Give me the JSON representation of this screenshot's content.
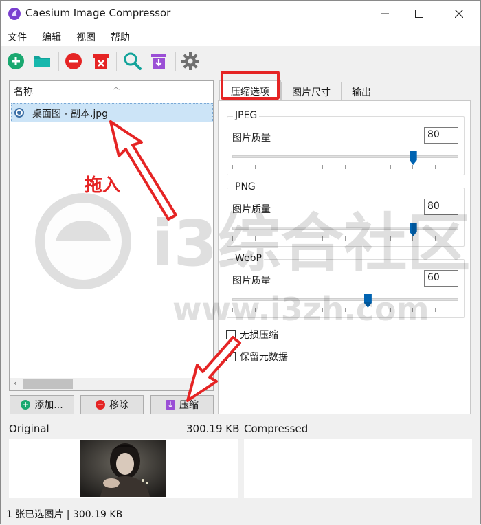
{
  "window": {
    "title": "Caesium Image Compressor",
    "controls": {
      "minimize": "—",
      "maximize": "☐",
      "close": "✕"
    }
  },
  "menu": [
    "文件",
    "编辑",
    "视图",
    "帮助"
  ],
  "toolbar": {
    "icons": [
      "add-icon",
      "open-folder-icon",
      "remove-icon",
      "clear-icon",
      "search-icon",
      "compress-archive-icon",
      "settings-icon"
    ]
  },
  "file_list": {
    "column_header": "名称",
    "items": [
      {
        "name": "桌面图 - 副本.jpg",
        "selected": true
      }
    ]
  },
  "buttons": {
    "add": "添加...",
    "remove": "移除",
    "compress": "压缩"
  },
  "tabs": [
    {
      "label": "压缩选项",
      "active": true
    },
    {
      "label": "图片尺寸",
      "active": false
    },
    {
      "label": "输出",
      "active": false
    }
  ],
  "compression": {
    "quality_label": "图片质量",
    "groups": [
      {
        "title": "JPEG",
        "quality": "80",
        "level": 80
      },
      {
        "title": "PNG",
        "quality": "80",
        "level": 80
      },
      {
        "title": "WebP",
        "quality": "60",
        "level": 60
      }
    ],
    "lossless": {
      "label": "无损压缩",
      "checked": false
    },
    "keep_metadata": {
      "label": "保留元数据",
      "checked": true
    }
  },
  "preview": {
    "original_label": "Original",
    "original_size": "300.19 KB",
    "compressed_label": "Compressed"
  },
  "status": "1 张已选图片 | 300.19 KB",
  "annotation": {
    "text": "拖入"
  },
  "watermark": {
    "text": "i3综合社区",
    "url": "www.i3zh.com"
  },
  "colors": {
    "accent_blue": "#0063b1",
    "green": "#1aa870",
    "red": "#e52424",
    "purple": "#9b4fd6",
    "teal": "#12a39a",
    "annotation_red": "#e52424"
  }
}
